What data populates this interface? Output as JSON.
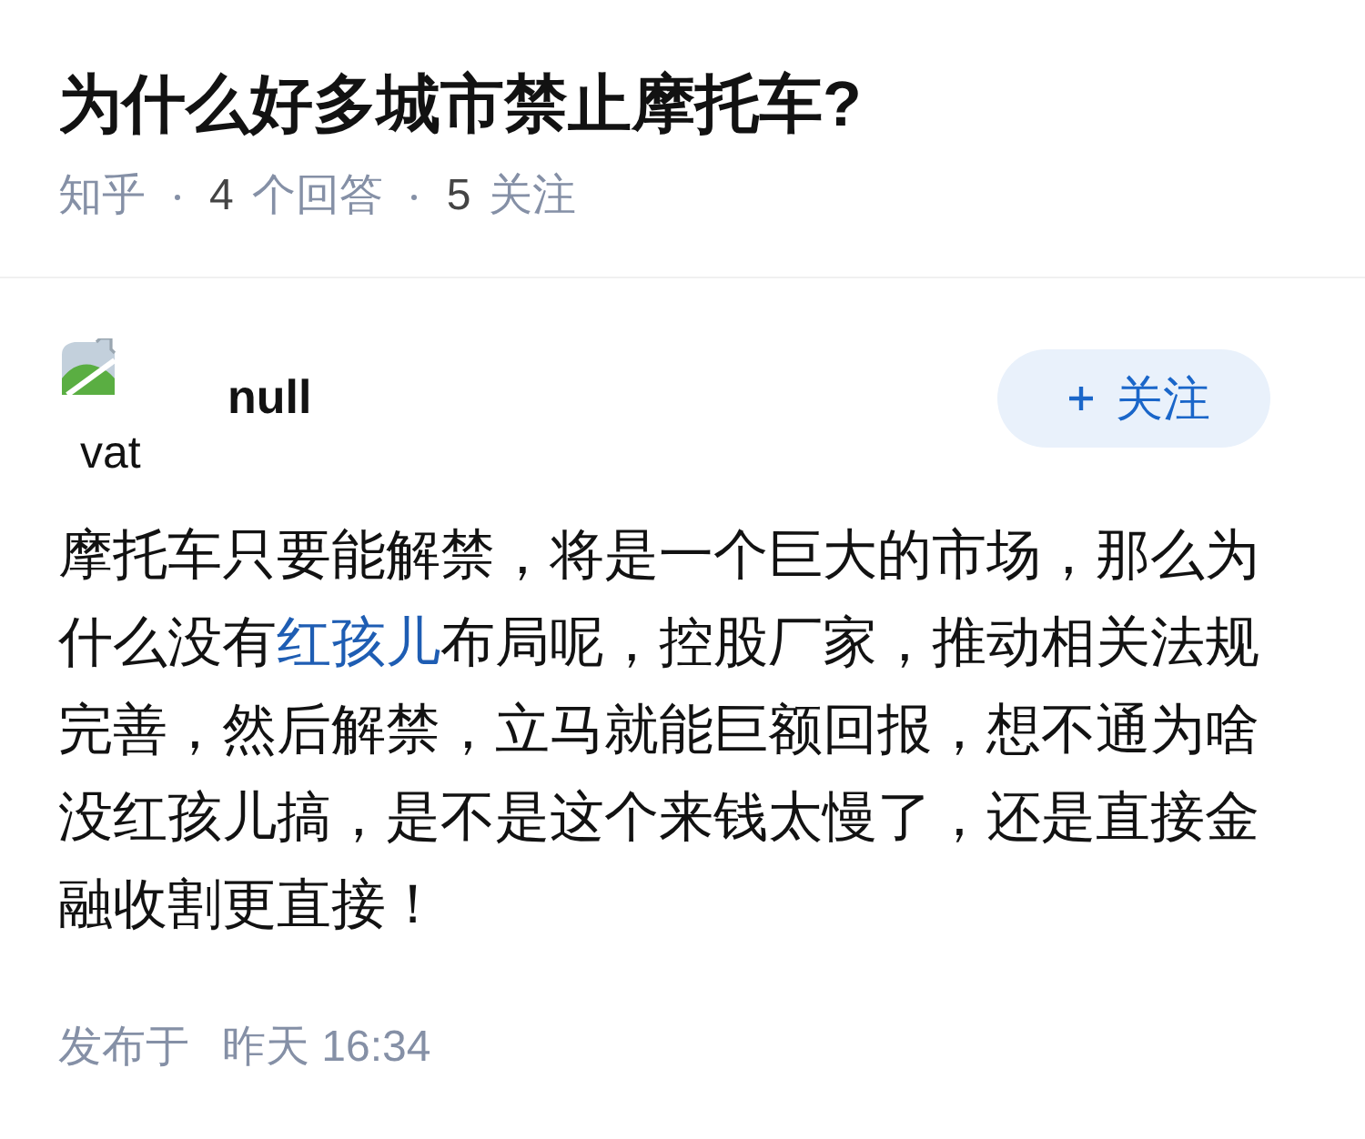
{
  "question": {
    "title": "为什么好多城市禁止摩托车?",
    "source": "知乎",
    "stats": [
      {
        "count": "4",
        "label": "个回答"
      },
      {
        "count": "5",
        "label": "关注"
      }
    ]
  },
  "answer": {
    "author": {
      "avatar_alt": "vat",
      "name": "null"
    },
    "follow_button": {
      "label": "关注"
    },
    "content": [
      {
        "kind": "text",
        "text": "摩托车只要能解禁，将是一个巨大的市场，那么为什么没有"
      },
      {
        "kind": "link",
        "text": "红孩儿"
      },
      {
        "kind": "text",
        "text": "布局呢，控股厂家，推动相关法规完善，然后解禁，立马就能巨额回报，想不通为啥没红孩儿搞，是不是这个来钱太慢了，还是直接金融收割更直接！"
      }
    ],
    "footer": {
      "label": "发布于",
      "time": "昨天 16:34"
    }
  }
}
